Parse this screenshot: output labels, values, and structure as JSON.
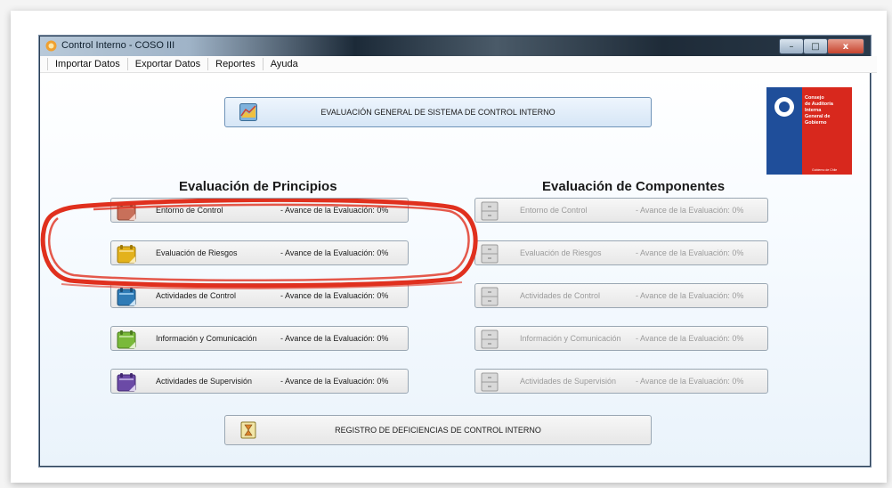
{
  "window": {
    "title": "Control Interno - COSO III",
    "controls": [
      "–",
      "□",
      "x"
    ]
  },
  "menu": [
    "Importar Datos",
    "Exportar Datos",
    "Reportes",
    "Ayuda"
  ],
  "top_button": {
    "label": "EVALUACIÓN GENERAL DE SISTEMA DE CONTROL INTERNO"
  },
  "bottom_button": {
    "label": "REGISTRO DE DEFICIENCIAS DE CONTROL INTERNO"
  },
  "principios": {
    "title": "Evaluación de Principios",
    "items": [
      {
        "name": "Entorno de Control",
        "progress": "- Avance de la Evaluación:  0%",
        "color": "#c8705a"
      },
      {
        "name": "Evaluación de Riesgos",
        "progress": "- Avance de la Evaluación:  0%",
        "color": "#e3b21d"
      },
      {
        "name": "Actividades de Control",
        "progress": "- Avance de la Evaluación:  0%",
        "color": "#2f7bb6"
      },
      {
        "name": "Información y Comunicación",
        "progress": "- Avance de la Evaluación:  0%",
        "color": "#79b93a"
      },
      {
        "name": "Actividades de Supervisión",
        "progress": "- Avance de la Evaluación:  0%",
        "color": "#6b4aa6"
      }
    ]
  },
  "componentes": {
    "title": "Evaluación de Componentes",
    "items": [
      {
        "name": "Entorno de Control",
        "progress": "- Avance de la Evaluación:  0%"
      },
      {
        "name": "Evaluación de Riesgos",
        "progress": "- Avance de la Evaluación:  0%"
      },
      {
        "name": "Actividades de Control",
        "progress": "- Avance de la Evaluación:  0%"
      },
      {
        "name": "Información y Comunicación",
        "progress": "- Avance de la Evaluación:  0%"
      },
      {
        "name": "Actividades de Supervisión",
        "progress": "- Avance de la Evaluación:  0%"
      }
    ]
  },
  "logo": {
    "lines": [
      "Consejo",
      "de Auditoría",
      "Interna",
      "General de",
      "Gobierno"
    ],
    "footer": "Gobierno de Chile",
    "colors": {
      "blue": "#1f4e9a",
      "red": "#d8281d"
    }
  },
  "annotation": {
    "color": "#e0301e"
  }
}
